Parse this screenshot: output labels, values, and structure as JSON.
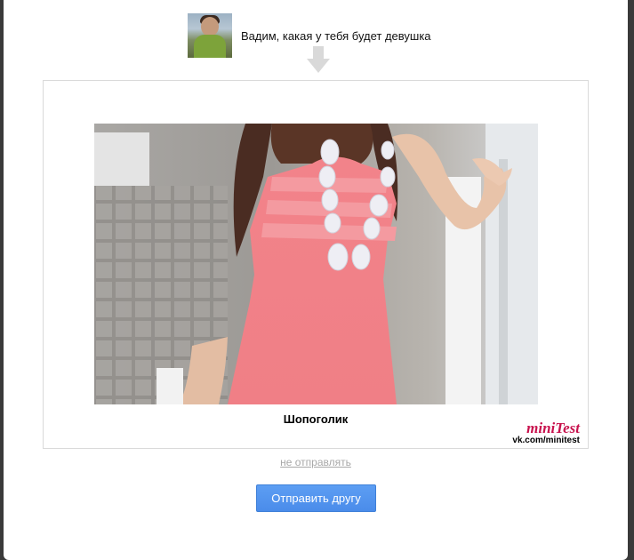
{
  "header": {
    "text": "Вадим, какая у тебя будет девушка",
    "avatar_icon": "user-photo"
  },
  "arrow_icon": "arrow-down-icon",
  "result": {
    "caption": "Шопоголик",
    "photo_subject": "girl-in-pink-dress",
    "brand_logo": "miniTest",
    "brand_url": "vk.com/minitest"
  },
  "actions": {
    "skip_label": "не отправлять",
    "send_label": "Отправить другу"
  },
  "colors": {
    "button": "#4a8cea",
    "brand": "#c8124d",
    "link": "#a8a8a8",
    "arrow": "#d9d9d9"
  }
}
